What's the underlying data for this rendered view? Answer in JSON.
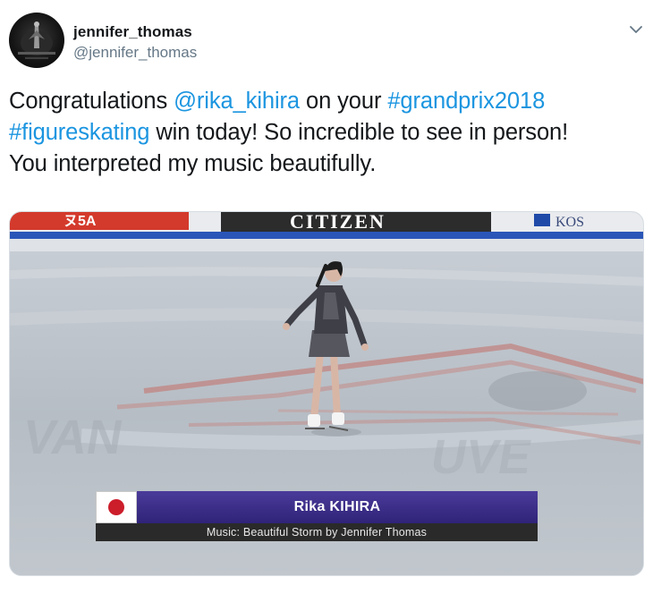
{
  "user": {
    "display_name": "jennifer_thomas",
    "handle": "@jennifer_thomas"
  },
  "tweet": {
    "line1": {
      "t1": "Congratulations ",
      "mention": "@rika_kihira",
      "t2": " on your ",
      "hashtag1": "#grandprix2018"
    },
    "line2": {
      "hashtag2": "#figureskating",
      "t3": " win today! So incredible to see in person!"
    },
    "line3": "You interpreted my music beautifully."
  },
  "media": {
    "board_sponsor_left": "ヌ5A",
    "board_sponsor_center": "CITIZEN",
    "board_sponsor_right": "KOS",
    "caption": {
      "name": "Rika KIHIRA",
      "music": "Music: Beautiful Storm by Jennifer Thomas",
      "flag_icon": "japan-flag-icon"
    }
  },
  "colors": {
    "link": "#1b95e0",
    "text": "#14171a",
    "secondary": "#657786",
    "caption_bar": "#3a2d88"
  },
  "icons": {
    "menu": "chevron-down-icon"
  }
}
